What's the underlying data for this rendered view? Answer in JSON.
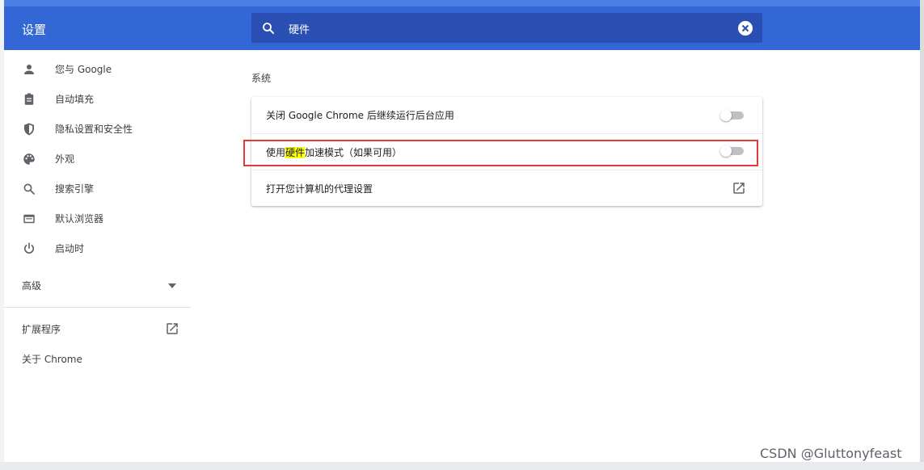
{
  "header": {
    "title": "设置"
  },
  "search": {
    "value": "硬件"
  },
  "sidebar": {
    "items": [
      {
        "label": "您与 Google",
        "icon": "person-icon"
      },
      {
        "label": "自动填充",
        "icon": "clipboard-icon"
      },
      {
        "label": "隐私设置和安全性",
        "icon": "shield-icon"
      },
      {
        "label": "外观",
        "icon": "palette-icon"
      },
      {
        "label": "搜索引擎",
        "icon": "search-icon"
      },
      {
        "label": "默认浏览器",
        "icon": "browser-icon"
      },
      {
        "label": "启动时",
        "icon": "power-icon"
      }
    ],
    "advanced_label": "高级",
    "extensions_label": "扩展程序",
    "about_label": "关于 Chrome"
  },
  "main": {
    "section_title": "系统",
    "rows": [
      {
        "text": "关闭 Google Chrome 后继续运行后台应用",
        "control": "toggle",
        "on": false
      },
      {
        "text_before": "使用",
        "highlight": "硬件",
        "text_after": "加速模式（如果可用）",
        "control": "toggle",
        "on": false
      },
      {
        "text": "打开您计算机的代理设置",
        "control": "external-link-icon"
      }
    ]
  },
  "watermark": "CSDN @Gluttonyfeast",
  "colors": {
    "header": "#3467d6",
    "search_bg": "#2a4fb3",
    "highlight": "#ffff00",
    "annotation": "#e53935"
  }
}
